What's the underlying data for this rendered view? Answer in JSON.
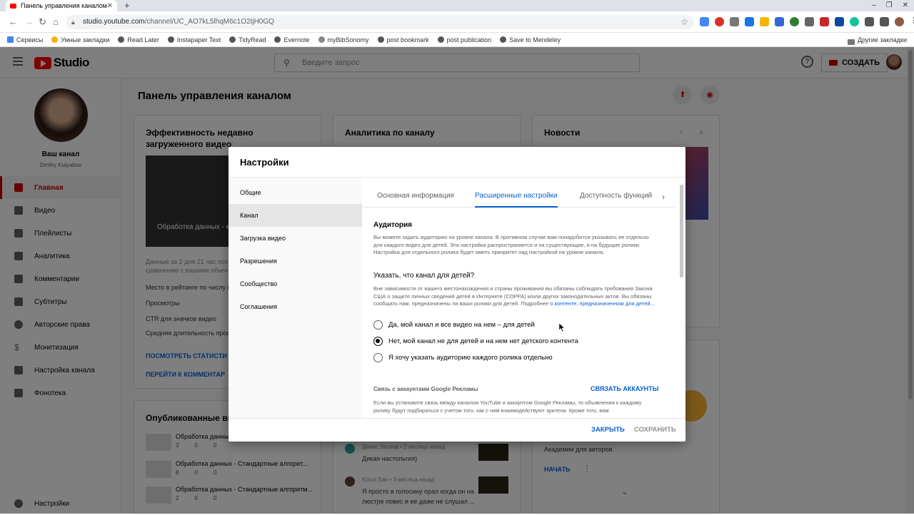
{
  "browser": {
    "tab_title": "Панель управления каналом",
    "url_host": "studio.youtube.com",
    "url_path": "/channel/UC_AO7kL5lhqM6c1O2tjH0GQ",
    "bookmarks": [
      "Сервисы",
      "Умные закладки",
      "Read Later",
      "Instapaper Text",
      "TidyRead",
      "Evernote",
      "myBibSonomy",
      "post bookmark",
      "post publication",
      "Save to Mendeley"
    ],
    "other_bookmarks": "Другие закладки"
  },
  "header": {
    "logo_text": "Studio",
    "search_placeholder": "Введите запрос",
    "create_label": "СОЗДАТЬ"
  },
  "sidebar": {
    "channel_title": "Ваш канал",
    "channel_owner": "Dmitry Kulyabov",
    "items": [
      {
        "label": "Главная",
        "icon": "dashboard-icon",
        "active": true
      },
      {
        "label": "Видео",
        "icon": "video-icon"
      },
      {
        "label": "Плейлисты",
        "icon": "playlist-icon"
      },
      {
        "label": "Аналитика",
        "icon": "analytics-icon"
      },
      {
        "label": "Комментарии",
        "icon": "comments-icon"
      },
      {
        "label": "Субтитры",
        "icon": "subtitles-icon"
      },
      {
        "label": "Авторские права",
        "icon": "copyright-icon"
      },
      {
        "label": "Монетизация",
        "icon": "dollar-icon"
      },
      {
        "label": "Настройка канала",
        "icon": "wand-icon"
      },
      {
        "label": "Фонотека",
        "icon": "audio-library-icon"
      }
    ],
    "settings_label": "Настройки"
  },
  "main": {
    "title": "Панель управления каналом",
    "card_perf_title": "Эффективность недавно загруженного видео",
    "card_perf_thumb_caption": "Обработка данных - многослойного перц",
    "card_perf_stats": [
      "Данные за 2 дня 21 час посл",
      "сравнению с вашими обычн",
      "Место в рейтинге по числу п",
      "Просмотры",
      "CTR для значков видео",
      "Средняя длительность прос"
    ],
    "card_perf_link1": "ПОСМОТРЕТЬ СТАТИСТИ",
    "card_perf_link2": "ПЕРЕЙТИ К КОММЕНТАР",
    "card_analytics_title": "Аналитика по каналу",
    "card_news_title": "Новости",
    "card_published_title": "Опубликованные ви",
    "published": [
      {
        "title": "Обработка данны",
        "views": "3",
        "comments": "0",
        "likes": "0"
      },
      {
        "title": "Обработка данных - Стандартные алгорит...",
        "views": "8",
        "comments": "0",
        "likes": "0"
      },
      {
        "title": "Обработка данных - Стандартные алгоритм...",
        "views": "2",
        "comments": "0",
        "likes": "0"
      }
    ],
    "comments": [
      {
        "author": "Денис Уколов • 2 месяца назад",
        "text": "Дикая настольгия)"
      },
      {
        "author": "Kizuri San • 3 месяца назад",
        "text": "Я просто в голосину орал когда он на",
        "text2": "люстре повис и ее даже не слушал ..."
      }
    ],
    "news_snippet": "Академии для авторов.",
    "news_button": "НАЧАТЬ"
  },
  "dialog": {
    "title": "Настройки",
    "nav": [
      "Общие",
      "Канал",
      "Загрузка видео",
      "Разрешения",
      "Сообщество",
      "Соглашения"
    ],
    "active_nav": 1,
    "tabs": [
      "Основная информация",
      "Расширенные настройки",
      "Доступность функций"
    ],
    "active_tab": 1,
    "audience_title": "Аудитория",
    "audience_text": "Вы можете задать аудиторию на уровне канала. В противном случае вам понадобится указывать ее отдельно для каждого видео для детей. Эта настройка распространяется и на существующие, и на будущие ролики. Настройка для отдельного ролика будет иметь приоритет над настройкой на уровне канала.",
    "kids_question": "Указать, что канал для детей?",
    "kids_text": "Вне зависимости от вашего местонахождения и страны проживания вы обязаны соблюдать требования Закона США о защите личных сведений детей в Интернете (COPPA) и/или других законодательных актов. Вы обязаны сообщать нам, предназначены ли ваши ролики для детей. Подробнее",
    "kids_link": "о контенте, предназначенном для детей...",
    "options": [
      {
        "label": "Да, мой канал и все видео на нем – для детей",
        "checked": false
      },
      {
        "label": "Нет, мой канал не для детей и на нем нет детского контента",
        "checked": true
      },
      {
        "label": "Я хочу указать аудиторию каждого ролика отдельно",
        "checked": false
      }
    ],
    "ads_title": "Связь с аккаунтами Google Рекламы",
    "ads_link": "СВЯЗАТЬ АККАУНТЫ",
    "ads_text": "Если вы установите связь между каналом YouTube и аккаунтом Google Рекламы, то объявления к каждому ролику будут подбираться с учетом того, как с ним взаимодействуют зрители. Кроме того, вам",
    "close_label": "ЗАКРЫТЬ",
    "save_label": "СОХРАНИТЬ"
  }
}
